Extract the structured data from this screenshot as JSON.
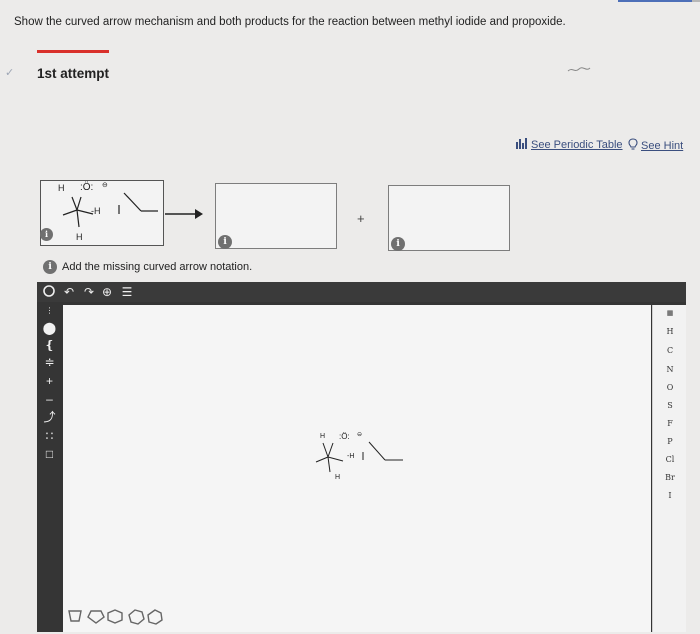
{
  "question": "Show the curved arrow mechanism and both products for the reaction between methyl iodide and propoxide.",
  "attempt": {
    "label": "1st attempt"
  },
  "links": {
    "periodic_table": "See Periodic Table",
    "hint": "See Hint"
  },
  "reaction": {
    "plus": "+",
    "molecule": {
      "h_top": "H",
      "oxygen": ":Ö:",
      "charge": "⊖",
      "h_methyl": "-H",
      "h_bottom": "H"
    }
  },
  "info": {
    "marker": "i",
    "message": "Add the missing curved arrow notation."
  },
  "editor": {
    "element_palette": [
      "H",
      "C",
      "N",
      "O",
      "S",
      "F",
      "P",
      "Cl",
      "Br",
      "I"
    ]
  },
  "colors": {
    "accent_red": "#d9302b",
    "link_blue": "#3a4e7e",
    "toolbar_dark": "#353535",
    "progress": "#4d6fb8"
  },
  "progress": 0.9
}
